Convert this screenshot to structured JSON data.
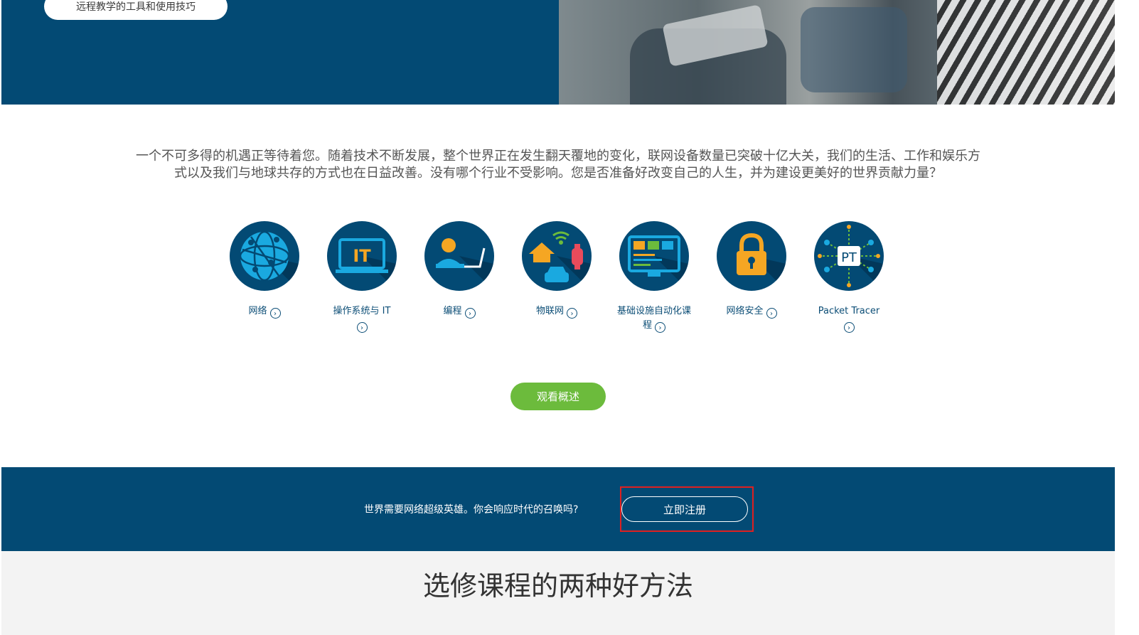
{
  "hero": {
    "pill_text": "远程教学的工具和使用技巧"
  },
  "intro": {
    "text": "一个不可多得的机遇正等待着您。随着技术不断发展，整个世界正在发生翻天覆地的变化，联网设备数量已突破十亿大关，我们的生活、工作和娱乐方式以及我们与地球共存的方式也在日益改善。没有哪个行业不受影响。您是否准备好改变自己的人生，并为建设更美好的世界贡献力量？"
  },
  "courses": [
    {
      "label": "网络",
      "icon": "globe-network-icon"
    },
    {
      "label": "操作系统与 IT",
      "icon": "it-monitor-icon"
    },
    {
      "label": "编程",
      "icon": "programmer-laptop-icon"
    },
    {
      "label": "物联网",
      "icon": "iot-devices-icon"
    },
    {
      "label": "基础设施自动化课程",
      "icon": "automation-code-icon"
    },
    {
      "label": "网络安全",
      "icon": "padlock-icon"
    },
    {
      "label": "Packet Tracer",
      "icon": "packet-tracer-icon"
    }
  ],
  "overview_button": "观看概述",
  "band": {
    "text": "世界需要网络超级英雄。你会响应时代的召唤吗?",
    "register_button": "立即注册"
  },
  "section": {
    "title": "选修课程的两种好方法"
  },
  "colors": {
    "brand_blue": "#034a74",
    "accent_green": "#6cbb3c",
    "highlight_red": "#e02020"
  }
}
